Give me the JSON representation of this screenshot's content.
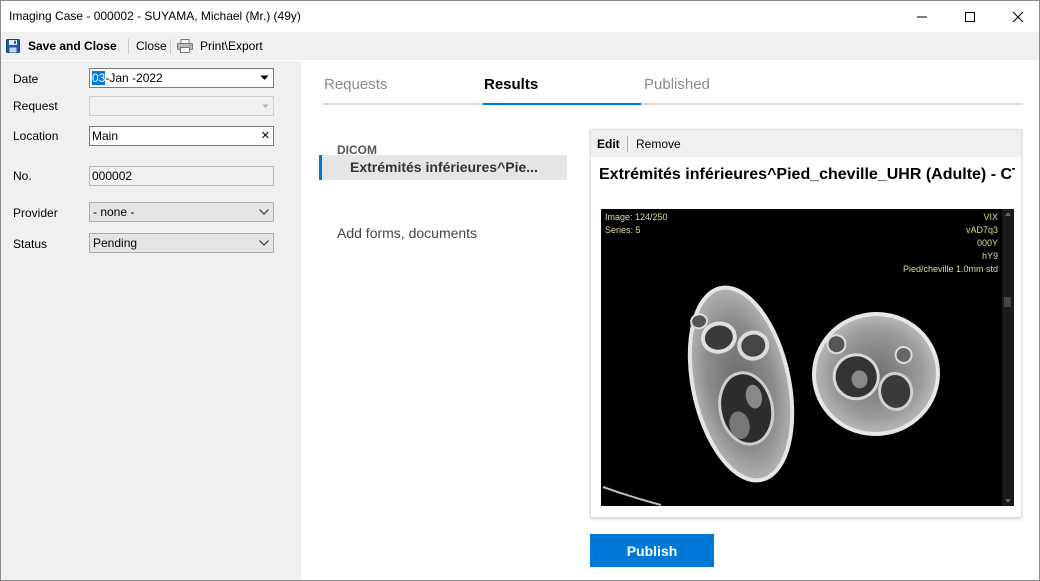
{
  "window": {
    "title": "Imaging Case - 000002 - SUYAMA, Michael (Mr.) (49y)"
  },
  "toolbar": {
    "save_close_label": "Save and Close",
    "close_label": "Close",
    "print_export_label": "Print\\Export"
  },
  "form": {
    "date_label": "Date",
    "date_day_selected": "03",
    "date_rest": "-Jan -2022",
    "request_label": "Request",
    "request_value": "",
    "location_label": "Location",
    "location_value": "Main",
    "no_label": "No.",
    "no_value": "000002",
    "provider_label": "Provider",
    "provider_value": "- none -",
    "status_label": "Status",
    "status_value": "Pending"
  },
  "tabs": [
    {
      "label": "Requests"
    },
    {
      "label": "Results"
    },
    {
      "label": "Published"
    }
  ],
  "results": {
    "group_header": "DICOM",
    "item_label": "Extrémités inférieures^Pie...",
    "add_forms_label": "Add forms, documents"
  },
  "card": {
    "edit_label": "Edit",
    "remove_label": "Remove",
    "title": "Extrémités inférieures^Pied_cheville_UHR (Adulte) - CT",
    "overlay": {
      "image": "Image: 124/250",
      "series": "Series: 5",
      "r1": "VIX",
      "r2": "vAD7q3",
      "r3": "000Y",
      "r4": "hY9",
      "r5": "Pied/cheville  1.0mm std"
    }
  },
  "publish_label": "Publish",
  "colors": {
    "accent": "#0078d7",
    "panel_bg": "#f0f0f0"
  }
}
